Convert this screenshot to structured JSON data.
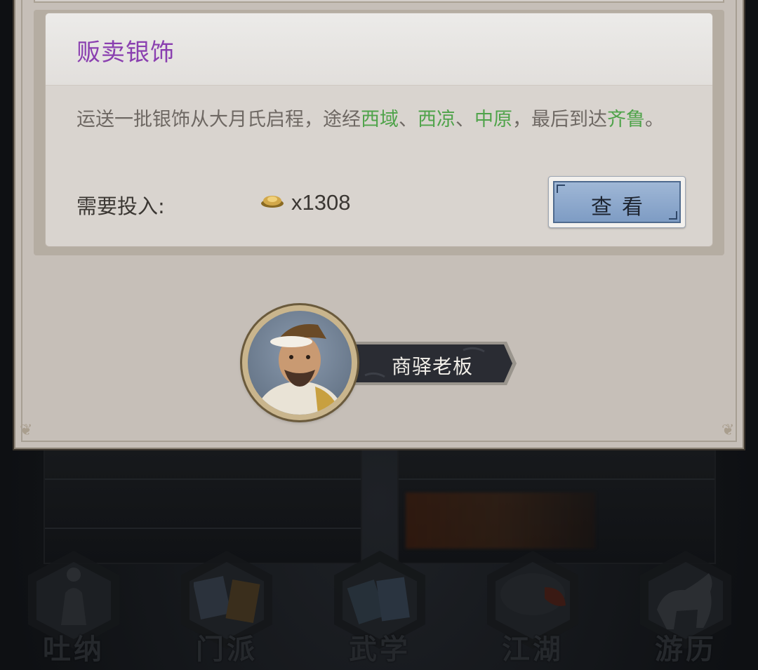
{
  "mission": {
    "title": "贩卖银饰",
    "description_parts": [
      {
        "text": "运送一批银饰从大月氏启程，途经",
        "highlight": false
      },
      {
        "text": "西域",
        "highlight": true
      },
      {
        "text": "、",
        "highlight": false
      },
      {
        "text": "西凉",
        "highlight": true
      },
      {
        "text": "、",
        "highlight": false
      },
      {
        "text": "中原",
        "highlight": true
      },
      {
        "text": "，最后到达",
        "highlight": false
      },
      {
        "text": "齐鲁",
        "highlight": true
      },
      {
        "text": "。",
        "highlight": false
      }
    ],
    "cost_label": "需要投入:",
    "cost_value": "x1308",
    "cost_icon": "gold-ingot-icon",
    "view_button": "查看"
  },
  "speaker": {
    "name": "商驿老板"
  },
  "bottom_nav": {
    "items": [
      {
        "label": "吐纳",
        "icon": "meditation-figure-icon"
      },
      {
        "label": "门派",
        "icon": "sect-banner-icon"
      },
      {
        "label": "武学",
        "icon": "martial-books-icon"
      },
      {
        "label": "江湖",
        "icon": "bamboo-hat-icon"
      },
      {
        "label": "游历",
        "icon": "horse-icon"
      }
    ]
  },
  "colors": {
    "title_purple": "#8a3fb0",
    "highlight_green": "#4fa34a",
    "button_blue": "#8aa7cd"
  }
}
